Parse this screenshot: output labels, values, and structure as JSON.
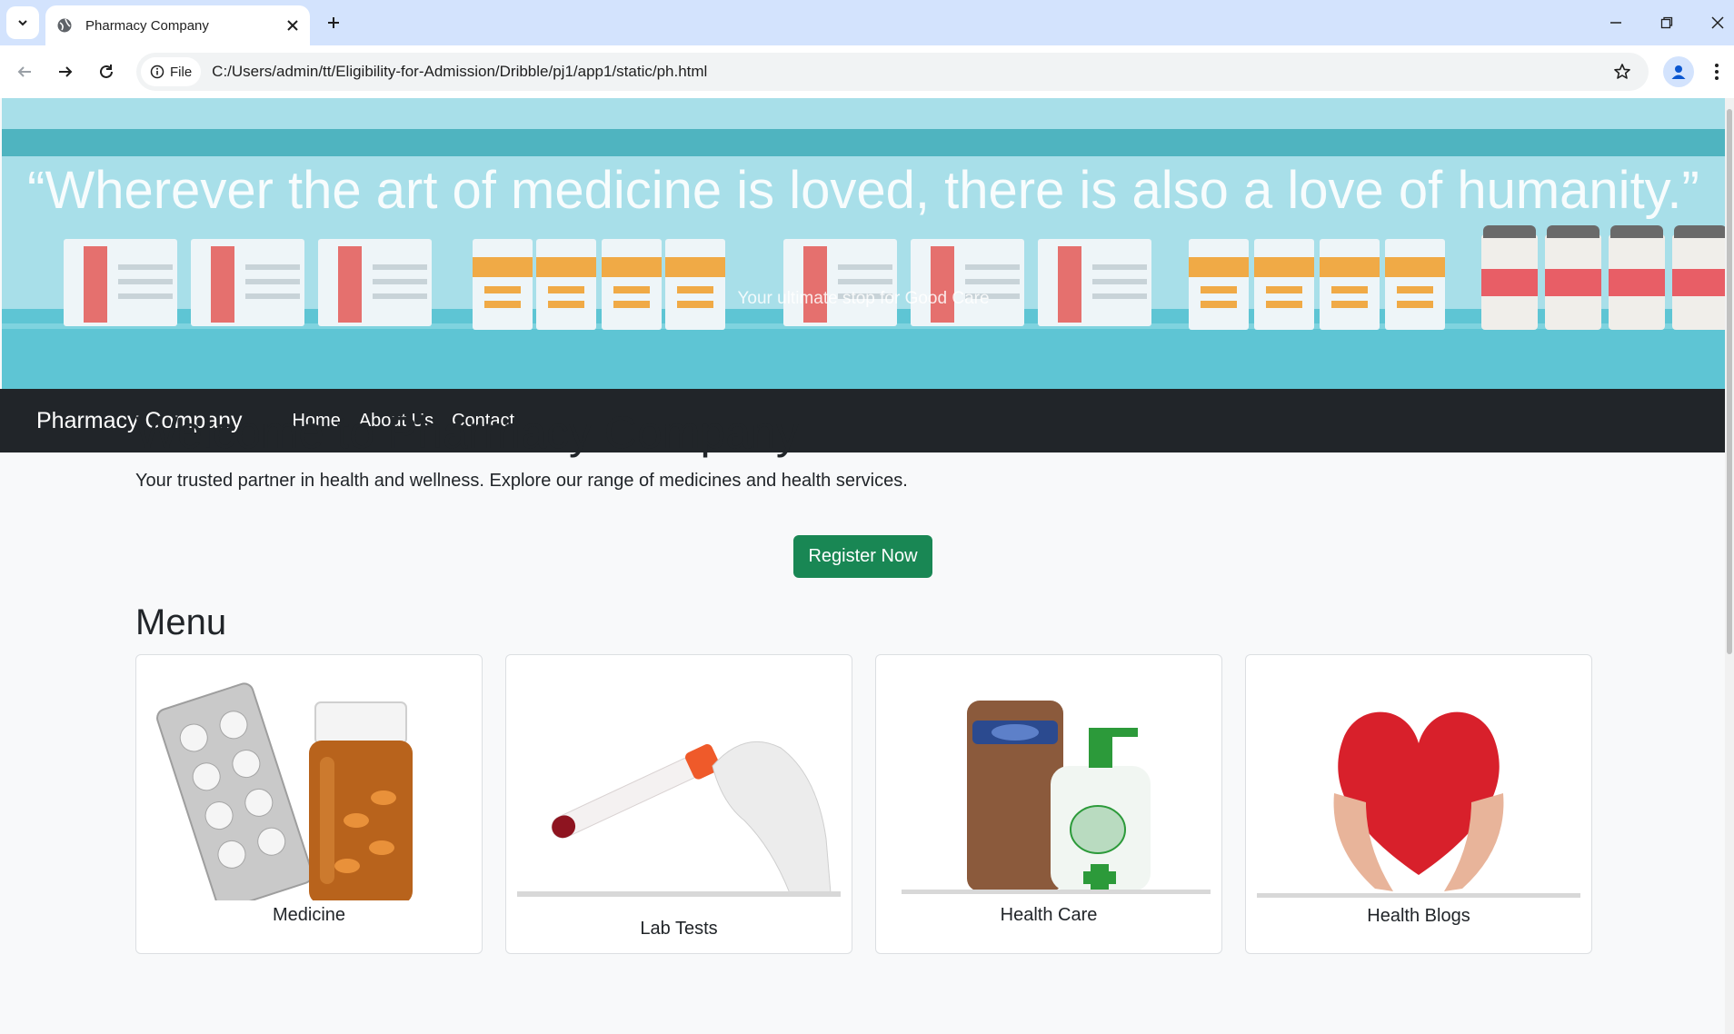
{
  "browser": {
    "tab_title": "Pharmacy Company",
    "file_chip": "File",
    "url": "C:/Users/admin/tt/Eligibility-for-Admission/Dribble/pj1/app1/static/ph.html"
  },
  "hero": {
    "quote": "“Wherever the art of medicine is loved, there is also a love of humanity.”",
    "subtitle": "Your ultimate stop for Good Care"
  },
  "navbar": {
    "brand": "Pharmacy Company",
    "links": [
      "Home",
      "About Us",
      "Contact"
    ]
  },
  "welcome": {
    "title": "Welcome to Pharmacy Company",
    "text": "Your trusted partner in health and wellness. Explore our range of medicines and health services."
  },
  "register_button": "Register Now",
  "menu": {
    "title": "Menu",
    "cards": [
      {
        "label": "Medicine",
        "icon": "pill-bottle-image"
      },
      {
        "label": "Lab Tests",
        "icon": "test-tube-image"
      },
      {
        "label": "Health Care",
        "icon": "lotion-soap-image"
      },
      {
        "label": "Health Blogs",
        "icon": "heart-hands-image"
      }
    ]
  },
  "colors": {
    "navbar": "#212529",
    "register": "#198754",
    "hero_bg": "#a8dfe9",
    "tabbar": "#d3e3fd"
  }
}
